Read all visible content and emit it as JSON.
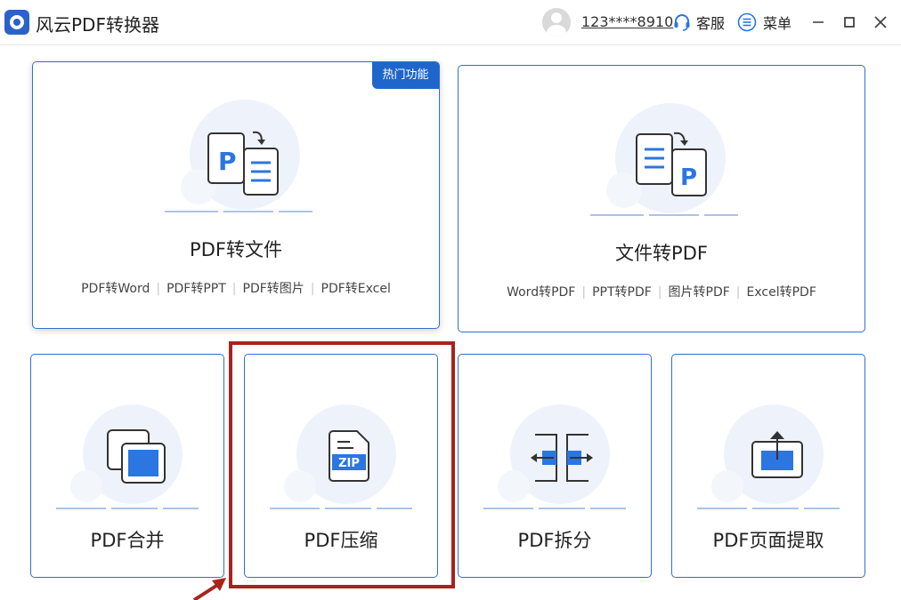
{
  "app": {
    "title": "风云PDF转换器"
  },
  "header": {
    "user_phone": "123****8910",
    "service_label": "客服",
    "menu_label": "菜单"
  },
  "cards": {
    "pdf_to_file": {
      "title": "PDF转文件",
      "badge": "热门功能",
      "links": [
        "PDF转Word",
        "PDF转PPT",
        "PDF转图片",
        "PDF转Excel"
      ]
    },
    "file_to_pdf": {
      "title": "文件转PDF",
      "links": [
        "Word转PDF",
        "PPT转PDF",
        "图片转PDF",
        "Excel转PDF"
      ]
    },
    "pdf_merge": {
      "title": "PDF合并"
    },
    "pdf_compress": {
      "title": "PDF压缩",
      "icon_text": "ZIP"
    },
    "pdf_split": {
      "title": "PDF拆分"
    },
    "pdf_extract": {
      "title": "PDF页面提取"
    }
  },
  "colors": {
    "accent": "#2f6fd0",
    "icon_blue": "#2b76e0",
    "badge_bg": "#1f66cc",
    "highlight": "#a8231d",
    "deco": "#eef2fa"
  },
  "icons": {
    "app": "app-logo-icon",
    "avatar": "avatar-icon",
    "service": "headset-icon",
    "menu": "list-icon",
    "minimize": "minimize-icon",
    "maximize": "maximize-icon",
    "close": "close-icon"
  }
}
